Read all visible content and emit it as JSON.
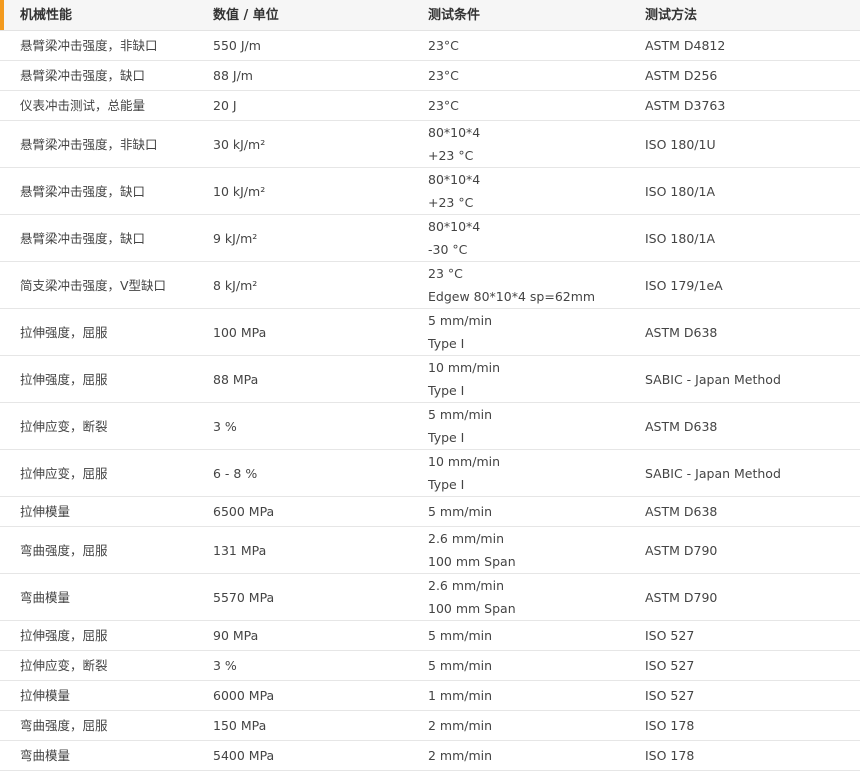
{
  "headers": [
    "机械性能",
    "数值 / 单位",
    "测试条件",
    "测试方法"
  ],
  "rows": [
    {
      "property": "悬臂梁冲击强度，非缺口",
      "value": "550 J/m",
      "conditions": [
        "23°C"
      ],
      "method": "ASTM D4812"
    },
    {
      "property": "悬臂梁冲击强度，缺口",
      "value": "88 J/m",
      "conditions": [
        "23°C"
      ],
      "method": "ASTM D256"
    },
    {
      "property": "仪表冲击测试，总能量",
      "value": "20 J",
      "conditions": [
        "23°C"
      ],
      "method": "ASTM D3763"
    },
    {
      "property": "悬臂梁冲击强度，非缺口",
      "value": "30 kJ/m²",
      "conditions": [
        "80*10*4",
        "+23 °C"
      ],
      "method": "ISO 180/1U"
    },
    {
      "property": "悬臂梁冲击强度，缺口",
      "value": "10 kJ/m²",
      "conditions": [
        "80*10*4",
        "+23 °C"
      ],
      "method": "ISO 180/1A"
    },
    {
      "property": "悬臂梁冲击强度，缺口",
      "value": "9 kJ/m²",
      "conditions": [
        "80*10*4",
        "-30 °C"
      ],
      "method": "ISO 180/1A"
    },
    {
      "property": "简支梁冲击强度，V型缺口",
      "value": "8 kJ/m²",
      "conditions": [
        "23 °C",
        "Edgew 80*10*4 sp=62mm"
      ],
      "method": "ISO 179/1eA"
    },
    {
      "property": "拉伸强度，屈服",
      "value": "100 MPa",
      "conditions": [
        "5 mm/min",
        "Type I"
      ],
      "method": "ASTM D638"
    },
    {
      "property": "拉伸强度，屈服",
      "value": "88 MPa",
      "conditions": [
        "10 mm/min",
        "Type I"
      ],
      "method": "SABIC - Japan Method"
    },
    {
      "property": "拉伸应变，断裂",
      "value": "3 %",
      "conditions": [
        "5 mm/min",
        "Type I"
      ],
      "method": "ASTM D638"
    },
    {
      "property": "拉伸应变，屈服",
      "value": "6 - 8 %",
      "conditions": [
        "10 mm/min",
        "Type I"
      ],
      "method": "SABIC - Japan Method"
    },
    {
      "property": "拉伸模量",
      "value": "6500 MPa",
      "conditions": [
        "5 mm/min"
      ],
      "method": "ASTM D638"
    },
    {
      "property": "弯曲强度，屈服",
      "value": "131 MPa",
      "conditions": [
        "2.6 mm/min",
        "100 mm Span"
      ],
      "method": "ASTM D790"
    },
    {
      "property": "弯曲模量",
      "value": "5570 MPa",
      "conditions": [
        "2.6 mm/min",
        "100 mm Span"
      ],
      "method": "ASTM D790"
    },
    {
      "property": "拉伸强度，屈服",
      "value": "90 MPa",
      "conditions": [
        "5 mm/min"
      ],
      "method": "ISO 527"
    },
    {
      "property": "拉伸应变，断裂",
      "value": "3 %",
      "conditions": [
        "5 mm/min"
      ],
      "method": "ISO 527"
    },
    {
      "property": "拉伸模量",
      "value": "6000 MPa",
      "conditions": [
        "1 mm/min"
      ],
      "method": "ISO 527"
    },
    {
      "property": "弯曲强度，屈服",
      "value": "150 MPa",
      "conditions": [
        "2 mm/min"
      ],
      "method": "ISO 178"
    },
    {
      "property": "弯曲模量",
      "value": "5400 MPa",
      "conditions": [
        "2 mm/min"
      ],
      "method": "ISO 178"
    }
  ],
  "colors": {
    "accent": "#f39a1e",
    "header_bg": "#f6f6f6",
    "border": "#e6e6e6",
    "text": "#444444"
  }
}
